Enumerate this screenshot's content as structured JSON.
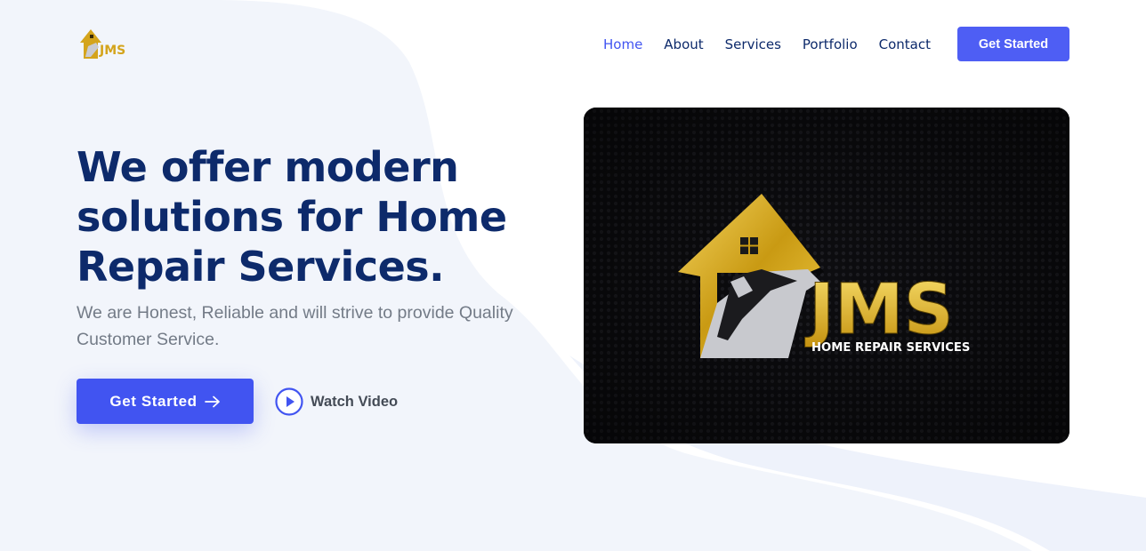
{
  "brand": {
    "logo_text": "JMS",
    "logo_subtext": "HOME REPAIR SERVICES"
  },
  "nav": {
    "items": [
      {
        "label": "Home",
        "active": true
      },
      {
        "label": "About",
        "active": false
      },
      {
        "label": "Services",
        "active": false
      },
      {
        "label": "Portfolio",
        "active": false
      },
      {
        "label": "Contact",
        "active": false
      }
    ],
    "cta_label": "Get Started"
  },
  "hero": {
    "title": "We offer modern solutions for Home Repair Services.",
    "subtitle": "We are Honest, Reliable and will strive to provide Quality Customer Service.",
    "primary_button": "Get Started",
    "video_button": "Watch Video",
    "image_brand": "JMS",
    "image_tagline": "HOME REPAIR SERVICES"
  },
  "colors": {
    "accent": "#4154f1",
    "heading": "#0d2a6b",
    "body_text": "#737b87",
    "gold": "#d4a41c",
    "background": "#f2f5fb"
  },
  "icons": {
    "button_arrow": "arrow-right-icon",
    "video": "play-circle-icon",
    "logo": "house-hammer-icon"
  }
}
